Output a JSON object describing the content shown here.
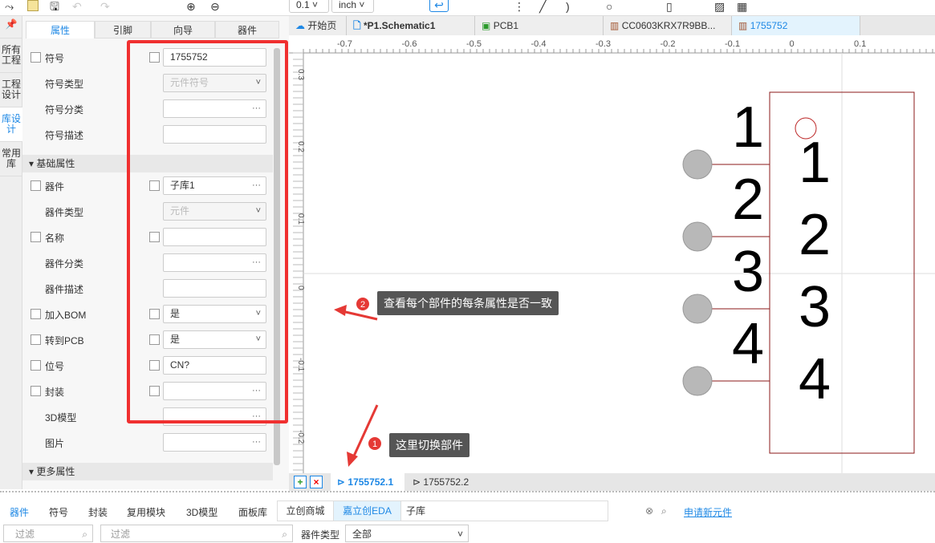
{
  "toolbar": {
    "grid": "0.1",
    "unit": "inch"
  },
  "vertical_tabs": [
    "所有工程",
    "工程设计",
    "库设计",
    "常用库"
  ],
  "panel": {
    "tabs": [
      "属性",
      "引脚",
      "向导",
      "器件"
    ],
    "rows": [
      {
        "label": "符号",
        "check": true,
        "value": "1755752",
        "right_check": true
      },
      {
        "label": "符号类型",
        "value": "元件符号",
        "disabled": true,
        "dropdown": true
      },
      {
        "label": "符号分类",
        "value": "",
        "more": true
      },
      {
        "label": "符号描述",
        "value": ""
      },
      {
        "section": "基础属性"
      },
      {
        "label": "器件",
        "check": true,
        "value": "子库1",
        "more": true,
        "right_check": true
      },
      {
        "label": "器件类型",
        "value": "元件",
        "disabled": true,
        "dropdown": true
      },
      {
        "label": "名称",
        "check": true,
        "value": "",
        "right_check": true
      },
      {
        "label": "器件分类",
        "value": "",
        "more": true
      },
      {
        "label": "器件描述",
        "value": ""
      },
      {
        "label": "加入BOM",
        "check": true,
        "value": "是",
        "dropdown": true,
        "right_check": true
      },
      {
        "label": "转到PCB",
        "check": true,
        "value": "是",
        "dropdown": true,
        "right_check": true
      },
      {
        "label": "位号",
        "check": true,
        "value": "CN?",
        "right_check": true
      },
      {
        "label": "封装",
        "check": true,
        "value": "",
        "more": true,
        "right_check": true
      },
      {
        "label": "3D模型",
        "value": "",
        "more": true
      },
      {
        "label": "图片",
        "value": "",
        "more": true
      },
      {
        "section": "更多属性"
      }
    ]
  },
  "doc_tabs": [
    "开始页",
    "*P1.Schematic1",
    "PCB1",
    "CC0603KRX7R9BB...",
    "1755752"
  ],
  "ruler_x": [
    "-0.7",
    "-0.6",
    "-0.5",
    "-0.4",
    "-0.3",
    "-0.2",
    "-0.1",
    "0",
    "0.1"
  ],
  "ruler_y": [
    "0.3",
    "0.2",
    "0.1",
    "0",
    "-0.1",
    "-0.2"
  ],
  "pins": {
    "outer": [
      "1",
      "2",
      "3",
      "4"
    ],
    "inner": [
      "1",
      "2",
      "3",
      "4"
    ]
  },
  "callouts": [
    {
      "num": "1",
      "text": "这里切换部件"
    },
    {
      "num": "2",
      "text": "查看每个部件的每条属性是否一致"
    }
  ],
  "part_tabs": [
    "1755752.1",
    "1755752.2"
  ],
  "lib": {
    "tabs": [
      "器件",
      "符号",
      "封装",
      "复用模块",
      "3D模型",
      "面板库"
    ],
    "sources": [
      "立创商城",
      "嘉立创EDA",
      "子库"
    ],
    "apply": "申请新元件",
    "filter1": "过滤",
    "filter2": "过滤",
    "type_label": "器件类型",
    "type_value": "全部"
  },
  "colors": {
    "accent": "#1e88e5",
    "highlight": "#f03030",
    "pin": "#b8b8b8",
    "body": "#8b1a1a"
  }
}
